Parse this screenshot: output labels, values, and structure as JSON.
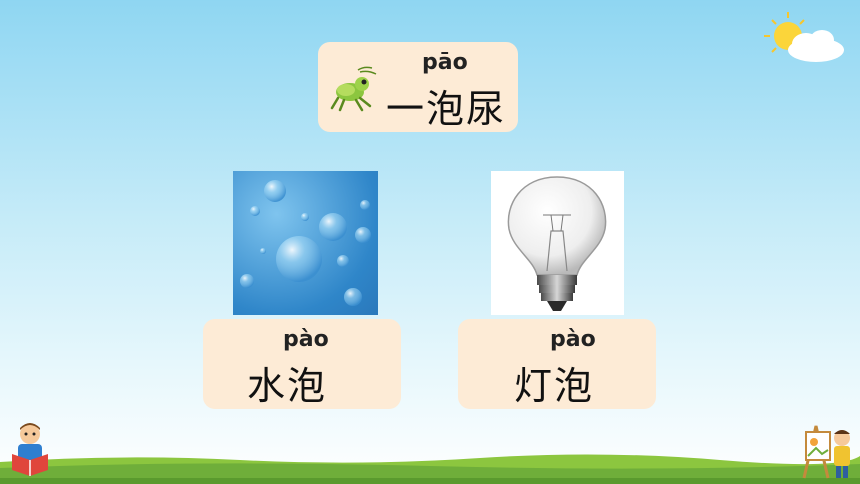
{
  "top_card": {
    "pinyin": "pāo",
    "word": "一泡尿"
  },
  "left_card": {
    "pinyin": "pào",
    "word": "水泡"
  },
  "right_card": {
    "pinyin": "pào",
    "word": "灯泡"
  },
  "icons": {
    "top": "cricket-icon",
    "sky": "sun-cloud-icon",
    "left_photo": "water-bubbles-image",
    "right_photo": "light-bulb-image",
    "bottom_left": "reading-child-icon",
    "bottom_right": "painting-child-icon"
  },
  "colors": {
    "card": "#fdebd6",
    "sky_top": "#8fd6f2",
    "grass": "#6fae3a"
  }
}
